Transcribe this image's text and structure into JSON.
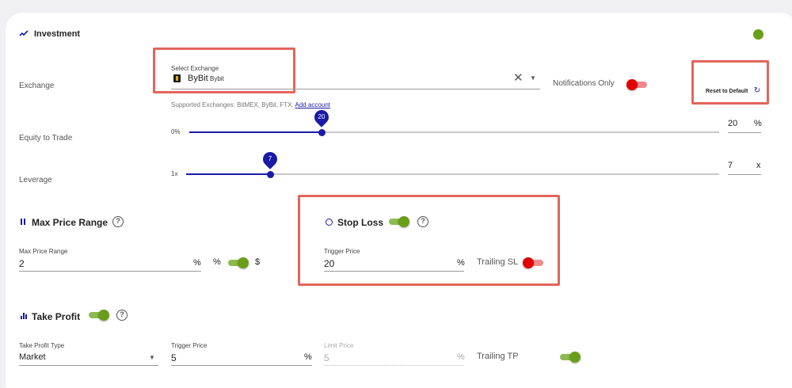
{
  "investment": {
    "title": "Investment",
    "icon": "trend-up-icon",
    "status_color": "#6a9d1a"
  },
  "exchange": {
    "label": "Exchange",
    "select_label": "Select Exchange",
    "selected_name": "ByBit",
    "selected_sub": "Bybit",
    "supported_text": "Supported Exchanges: BitMEX, ByBit, FTX.",
    "add_account": "Add account",
    "notifications_label": "Notifications Only",
    "notifications_on": false,
    "reset_label": "Reset to Default"
  },
  "equity": {
    "label": "Equity to Trade",
    "min_label": "0%",
    "value": "20",
    "unit": "%",
    "fraction": 0.25
  },
  "leverage": {
    "label": "Leverage",
    "min_label": "1x",
    "value": "7",
    "unit": "x",
    "fraction": 0.158
  },
  "max_price_range": {
    "title": "Max Price Range",
    "field_label": "Max Price Range",
    "value": "2",
    "unit": "%",
    "toggle_left": "%",
    "toggle_right": "$",
    "toggle_on": true
  },
  "stop_loss": {
    "title": "Stop Loss",
    "enabled": true,
    "trigger_label": "Trigger Price",
    "trigger_value": "20",
    "trigger_unit": "%",
    "trailing_label": "Trailing SL",
    "trailing_on": false
  },
  "take_profit": {
    "title": "Take Profit",
    "enabled": true,
    "type_label": "Take Profit Type",
    "type_value": "Market",
    "trigger_label": "Trigger Price",
    "trigger_value": "5",
    "trigger_unit": "%",
    "limit_label": "Limit Price",
    "limit_value": "5",
    "limit_unit": "%",
    "trailing_label": "Trailing TP",
    "trailing_on": true
  },
  "colors": {
    "accent": "#1a1aa6",
    "on": "#6a9d1a",
    "off": "#e00000",
    "highlight": "#e2655b"
  }
}
